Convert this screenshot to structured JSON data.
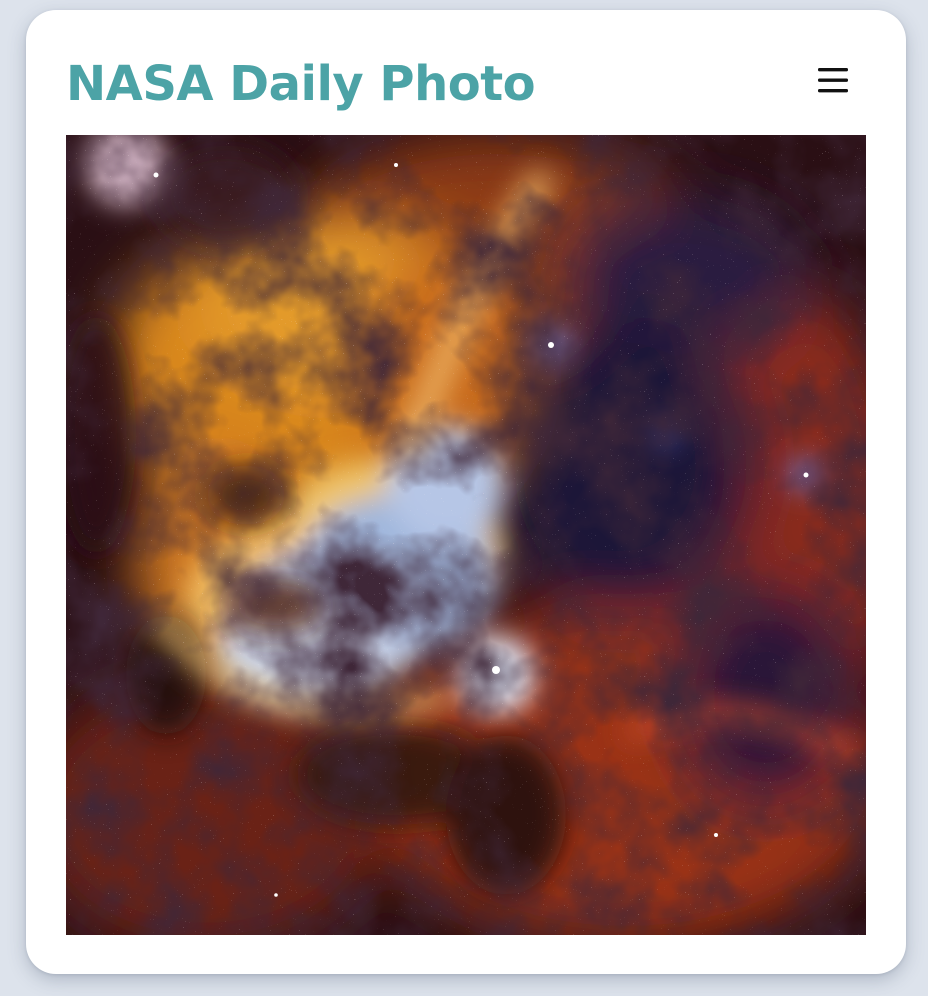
{
  "header": {
    "title": "NASA Daily Photo",
    "menu_icon": "hamburger-menu-icon"
  },
  "photo": {
    "subject": "nebula-photo"
  },
  "colors": {
    "title": "#4ca3a6",
    "background": "#dde3ec",
    "card": "#ffffff",
    "icon": "#111111"
  }
}
